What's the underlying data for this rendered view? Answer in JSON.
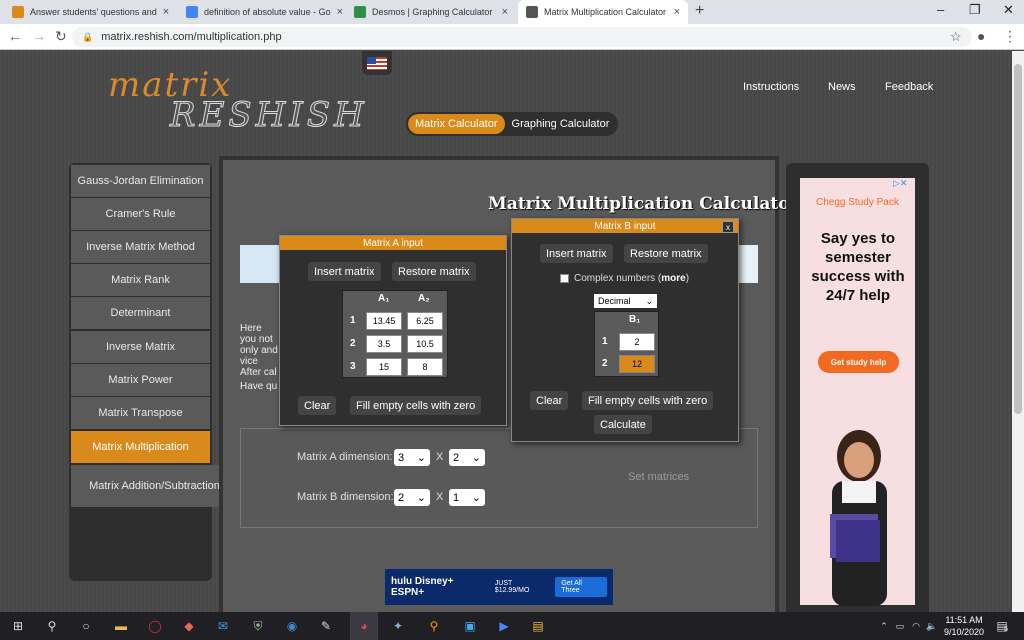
{
  "browser": {
    "tabs": [
      {
        "title": "Answer students' questions and",
        "color": "#d98a1a"
      },
      {
        "title": "definition of absolute value - Go",
        "color": "#4285f4"
      },
      {
        "title": "Desmos | Graphing Calculator",
        "color": "#2f8f46"
      },
      {
        "title": "Matrix Multiplication Calculator",
        "color": "#555555"
      }
    ],
    "url": "matrix.reshish.com/multiplication.php"
  },
  "site": {
    "logo_top": "matrix",
    "logo_bottom": "RESHISH",
    "nav": [
      "Instructions",
      "News",
      "Feedback"
    ],
    "calc_tabs": [
      "Matrix Calculator",
      "Graphing Calculator"
    ]
  },
  "sidebar": {
    "items": [
      "Gauss-Jordan Elimination",
      "Cramer's Rule",
      "Inverse Matrix Method",
      "Matrix Rank",
      "Determinant",
      "Inverse Matrix",
      "Matrix Power",
      "Matrix Transpose",
      "Matrix Multiplication",
      "Matrix Addition/Subtraction"
    ],
    "active_index": 8
  },
  "main": {
    "title": "Matrix Multiplication Calculator",
    "intro": "Here you not only and vice After cal",
    "have_q": "Have qu",
    "dim_a_label": "Matrix A dimension:",
    "dim_a_rows": "3",
    "dim_a_cols": "2",
    "dim_b_label": "Matrix B dimension:",
    "dim_b_rows": "2",
    "dim_b_cols": "1",
    "x": "X",
    "set_matrices": "Set matrices"
  },
  "dialog_a": {
    "title": "Matrix A input",
    "insert": "Insert matrix",
    "restore": "Restore matrix",
    "col_headers": [
      "A₁",
      "A₂"
    ],
    "row_labels": [
      "1",
      "2",
      "3"
    ],
    "values": [
      [
        "13.45",
        "6.25"
      ],
      [
        "3.5",
        "10.5"
      ],
      [
        "15",
        "8"
      ]
    ],
    "clear": "Clear",
    "fill_zero": "Fill empty cells with zero"
  },
  "dialog_b": {
    "title": "Matrix B input",
    "close": "x",
    "insert": "Insert matrix",
    "restore": "Restore matrix",
    "complex_label": "Complex numbers (",
    "complex_more": "more",
    "complex_close": ")",
    "number_format": "Decimal",
    "col_headers": [
      "B₁"
    ],
    "row_labels": [
      "1",
      "2"
    ],
    "values": [
      [
        "2"
      ],
      [
        "12"
      ]
    ],
    "clear": "Clear",
    "fill_zero": "Fill empty cells with zero",
    "calculate": "Calculate"
  },
  "ad_right": {
    "brand": "Chegg Study Pack",
    "headline": "Say yes to semester success with 24/7 help",
    "cta": "Get study help"
  },
  "ad_bottom": {
    "brands": "hulu Disney+ ESPN+",
    "price": "JUST $12.99/MO",
    "cta": "Get All Three"
  },
  "taskbar": {
    "time": "11:51 AM",
    "date": "9/10/2020",
    "notifications": "5"
  }
}
